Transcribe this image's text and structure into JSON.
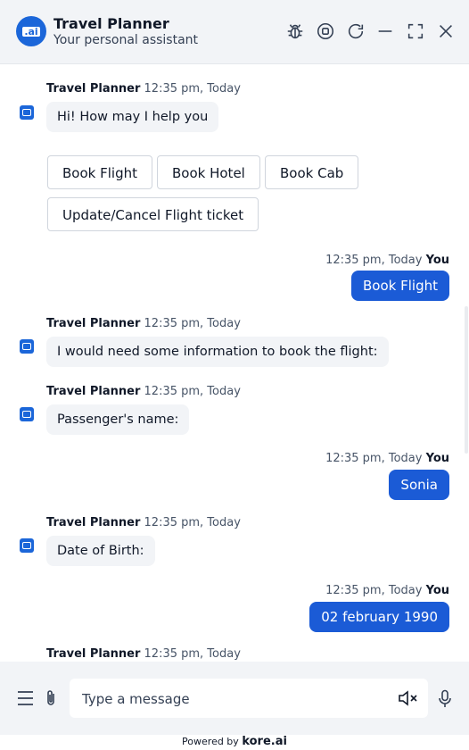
{
  "header": {
    "title": "Travel Planner",
    "subtitle": "Your personal assistant",
    "icons": [
      "bug-icon",
      "stop-icon",
      "refresh-icon",
      "minimize-icon",
      "expand-icon",
      "close-icon"
    ]
  },
  "messages": [
    {
      "sender": "Travel Planner",
      "time": "12:35 pm, Today",
      "text": "Hi! How may I help you"
    },
    {
      "sender": "You",
      "time": "12:35 pm, Today",
      "text": "Book Flight"
    },
    {
      "sender": "Travel Planner",
      "time": "12:35 pm, Today",
      "text": "I would need some information to book the flight:"
    },
    {
      "sender": "Travel Planner",
      "time": "12:35 pm, Today",
      "text": "Passenger's name:"
    },
    {
      "sender": "You",
      "time": "12:35 pm, Today",
      "text": "Sonia"
    },
    {
      "sender": "Travel Planner",
      "time": "12:35 pm, Today",
      "text": "Date of Birth:"
    },
    {
      "sender": "You",
      "time": "12:35 pm, Today",
      "text": "02 february 1990"
    },
    {
      "sender": "Travel Planner",
      "time": "12:35 pm, Today",
      "text": ""
    }
  ],
  "quick_replies": [
    "Book Flight",
    "Book Hotel",
    "Book Cab",
    "Update/Cancel Flight ticket"
  ],
  "composer": {
    "placeholder": "Type a message"
  },
  "footer": {
    "powered_by": "Powered by",
    "brand": "kore.ai"
  },
  "colors": {
    "accent": "#1b5bd6",
    "bot_bubble": "#f2f4f7",
    "header_bg": "#f2f4f7"
  }
}
